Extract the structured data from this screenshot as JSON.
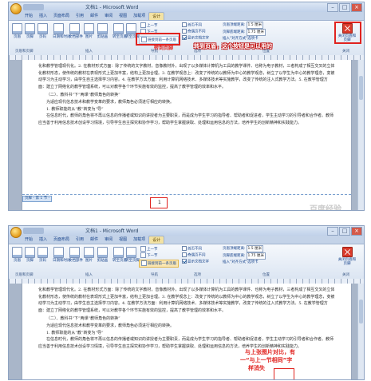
{
  "window": {
    "title": "文档1 - Microsoft Word",
    "controls": [
      "–",
      "□",
      "×"
    ]
  },
  "tabs": [
    "开始",
    "插入",
    "页面布局",
    "引用",
    "邮件",
    "审阅",
    "视图",
    "加载项",
    "设计"
  ],
  "active_tab": "设计",
  "ribbon": {
    "buttons": [
      "页眉",
      "页脚",
      "页码",
      "日期和时间",
      "文档部件",
      "图片",
      "剪贴画",
      "转至页眉",
      "转至页脚"
    ],
    "nav": {
      "prev": "上一节",
      "next": "下一节",
      "link": "链接到前一条页眉"
    },
    "options": [
      {
        "label": "首页不同",
        "checked": false
      },
      {
        "label": "奇偶页不同",
        "checked": false
      },
      {
        "label": "显示文档文字",
        "checked": true
      }
    ],
    "position": {
      "header_label": "页眉顶端距离:",
      "header_value": "1.5 厘米",
      "footer_label": "页脚底端距离:",
      "footer_value": "1.75 厘米",
      "align_tab": "插入\"对齐方式\"选项卡"
    },
    "close": "关闭页眉和页脚",
    "groups": [
      "页眉和页脚",
      "插入",
      "导航",
      "选项",
      "位置",
      "关闭"
    ]
  },
  "document": {
    "paragraphs": [
      "化和教学管理现代化。2. 在教材形式方面：除了传统的文字教材，音像教材外，出现了以多媒体计算机为工具的教学课件、也称为电子教材，三者构成了相互交叉的立体化教材形态，使传统的教材在表现形式上更加丰富，结构上更加合理。3. 在教学观念上：改变了传统的以教师为中心的教学观念，树立了以学生为中心的教学理念，变被动学习为主动学习，由学生自主选择学习内容。4. 在教学方法方面：利用计算机网络技术、多媒体技术等实施教学，改变了传统的注入式教学方法。5. 在教学管理方面：建立了网络化的教学管理系统，可以对教学各个环节实施有效的监控，提高了教学管理的效率和水平。",
      "（二）、教科书“下”两课“教师角色的转换”",
      "为适应现代信息技术和教学变革的要求，教师角色必须进行相应的转换。",
      "1. 教师职能的从“教”转变为“导”",
      "在信息时代，教师的角色将不再以信息的传播者或知识的讲授者为主要职责，而是成为学生学习的指导者、帮助者和促进者，学生主动学习的引导者和合作者。教师应当善于利用信息技术创设学习情境，引导学生自主探究和协作学习，帮助学生掌握获取、处理和运用信息的方法，培养学生的创新精神和实践能力。"
    ],
    "header_tag": "页脚 - 第 1 节 -",
    "caret": "1"
  },
  "annotations": {
    "top": "转到页眉，这个按钮是可以用的",
    "top_arrow": "转到页脚",
    "bottom_1": "与上张图片对比，有",
    "bottom_2": "一“与上一节相同”字",
    "bottom_3": "样消失"
  },
  "watermark": "百度经验"
}
